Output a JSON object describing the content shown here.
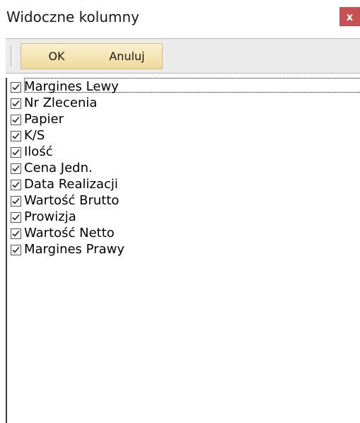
{
  "window": {
    "title": "Widoczne kolumny",
    "close_glyph": "x",
    "close_color": "#c75050"
  },
  "toolbar": {
    "ok_label": "OK",
    "cancel_label": "Anuluj",
    "button_fill": "#efd99a"
  },
  "columns": {
    "items": [
      {
        "label": "Margines Lewy",
        "checked": true
      },
      {
        "label": "Nr Zlecenia",
        "checked": true
      },
      {
        "label": "Papier",
        "checked": true
      },
      {
        "label": "K/S",
        "checked": true
      },
      {
        "label": "Ilość",
        "checked": true
      },
      {
        "label": "Cena Jedn.",
        "checked": true
      },
      {
        "label": "Data Realizacji",
        "checked": true
      },
      {
        "label": "Wartość Brutto",
        "checked": true
      },
      {
        "label": "Prowizja",
        "checked": true
      },
      {
        "label": "Wartość Netto",
        "checked": true
      },
      {
        "label": "Margines Prawy",
        "checked": true
      }
    ],
    "focused_index": 0
  }
}
